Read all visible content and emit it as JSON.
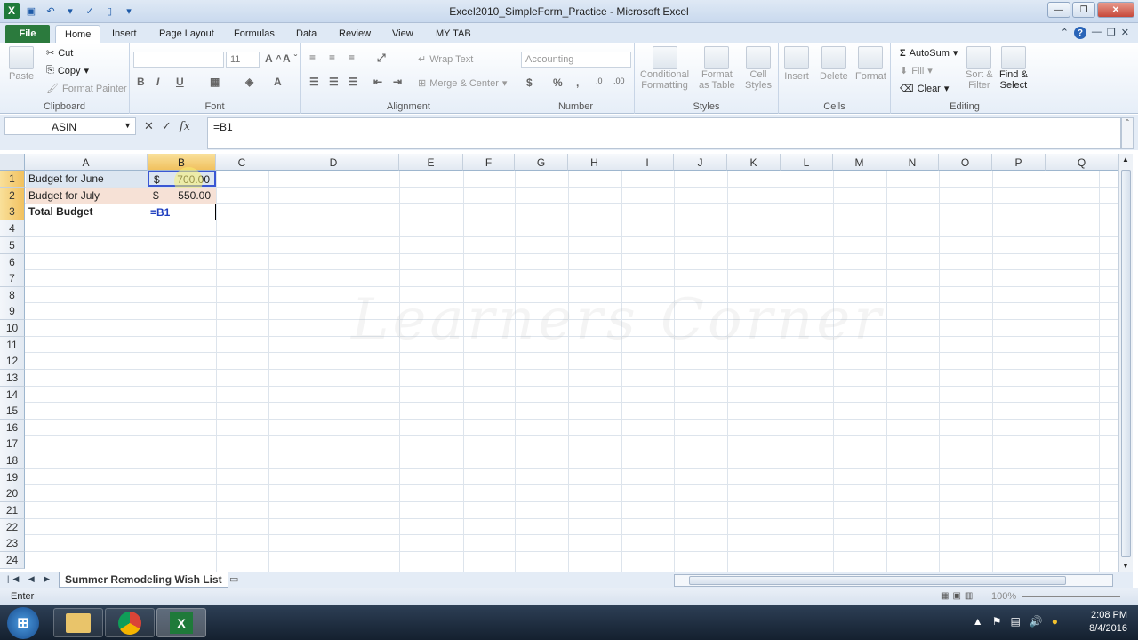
{
  "window": {
    "title": "Excel2010_SimpleForm_Practice - Microsoft Excel"
  },
  "tabs": [
    "File",
    "Home",
    "Insert",
    "Page Layout",
    "Formulas",
    "Data",
    "Review",
    "View",
    "MY TAB"
  ],
  "ribbon": {
    "clipboard": {
      "paste": "Paste",
      "cut": "Cut",
      "copy": "Copy",
      "format_painter": "Format Painter",
      "label": "Clipboard"
    },
    "font": {
      "size": "11",
      "label": "Font"
    },
    "alignment": {
      "wrap_text": "Wrap Text",
      "merge_center": "Merge & Center",
      "label": "Alignment"
    },
    "number": {
      "format": "Accounting",
      "label": "Number"
    },
    "styles": {
      "conditional": "Conditional",
      "formatting": "Formatting",
      "format_as": "Format",
      "as_table": "as Table",
      "cell": "Cell",
      "cell_styles": "Styles",
      "label": "Styles"
    },
    "cells": {
      "insert": "Insert",
      "delete": "Delete",
      "format": "Format",
      "label": "Cells"
    },
    "editing": {
      "autosum": "AutoSum",
      "fill": "Fill",
      "clear": "Clear",
      "sort": "Sort &",
      "filter": "Filter",
      "find": "Find &",
      "select": "Select",
      "label": "Editing"
    }
  },
  "formula_bar": {
    "name_box": "ASIN",
    "formula": "=B1"
  },
  "columns": [
    "A",
    "B",
    "C",
    "D",
    "E",
    "F",
    "G",
    "H",
    "I",
    "J",
    "K",
    "L",
    "M",
    "N",
    "O",
    "P",
    "Q"
  ],
  "rows": [
    "1",
    "2",
    "3",
    "4",
    "5",
    "6",
    "7",
    "8",
    "9",
    "10",
    "11",
    "12",
    "13",
    "14",
    "15",
    "16",
    "17",
    "18",
    "19",
    "20",
    "21",
    "22",
    "23",
    "24"
  ],
  "cells": {
    "a1": "Budget for June",
    "a2": "Budget for July",
    "a3": "Total Budget",
    "b1_symbol": "$",
    "b1_value": "700.00",
    "b2_symbol": "$",
    "b2_value": "550.00",
    "b3": "=B1"
  },
  "watermark": "Learners Corner",
  "sheet_tab": "Summer Remodeling Wish List",
  "status": {
    "mode": "Enter",
    "zoom": "100%"
  },
  "taskbar": {
    "time": "2:08 PM",
    "date": "8/4/2016"
  }
}
